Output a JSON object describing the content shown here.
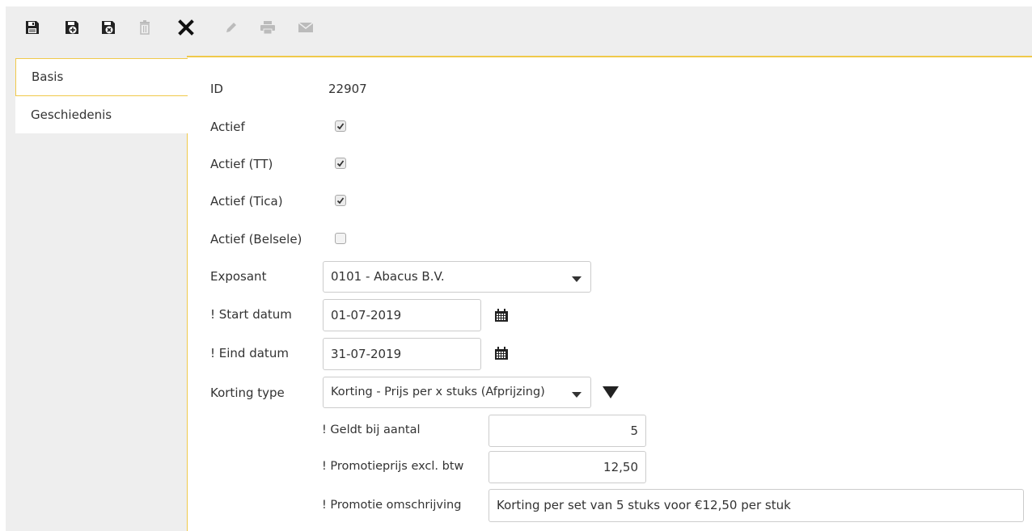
{
  "toolbar": {
    "buttons": [
      {
        "icon": "save-icon",
        "enabled": true
      },
      {
        "icon": "save-and-new-icon",
        "enabled": true
      },
      {
        "icon": "save-and-close-icon",
        "enabled": true
      },
      {
        "icon": "delete-icon",
        "enabled": false
      },
      {
        "icon": "close-icon",
        "enabled": true
      },
      {
        "icon": "edit-icon",
        "enabled": false
      },
      {
        "icon": "print-icon",
        "enabled": false
      },
      {
        "icon": "mail-icon",
        "enabled": false
      }
    ]
  },
  "tabs": [
    {
      "label": "Basis",
      "active": true
    },
    {
      "label": "Geschiedenis",
      "active": false
    }
  ],
  "form": {
    "id": {
      "label": "ID",
      "value": "22907"
    },
    "actief": {
      "label": "Actief",
      "checked": true
    },
    "actief_tt": {
      "label": "Actief (TT)",
      "checked": true
    },
    "actief_tica": {
      "label": "Actief (Tica)",
      "checked": true
    },
    "actief_belsele": {
      "label": "Actief (Belsele)",
      "checked": false
    },
    "exposant": {
      "label": "Exposant",
      "value": "0101 - Abacus B.V."
    },
    "start_datum": {
      "label": "! Start datum",
      "value": "01-07-2019"
    },
    "eind_datum": {
      "label": "! Eind datum",
      "value": "31-07-2019"
    },
    "korting_type": {
      "label": "Korting type",
      "value": "Korting - Prijs per x stuks (Afprijzing)"
    },
    "geldt_bij_aantal": {
      "label": "! Geldt bij aantal",
      "value": "5"
    },
    "promotieprijs": {
      "label": "! Promotieprijs excl. btw",
      "value": "12,50"
    },
    "promotie_omschrijving": {
      "label": "! Promotie omschrijving",
      "value": "Korting per set van 5 stuks voor €12,50 per stuk"
    }
  },
  "colors": {
    "accent": "#f0c94a",
    "panel_bg": "#eeeeee",
    "icon_enabled": "#222222",
    "icon_disabled": "#bbbbbb"
  }
}
